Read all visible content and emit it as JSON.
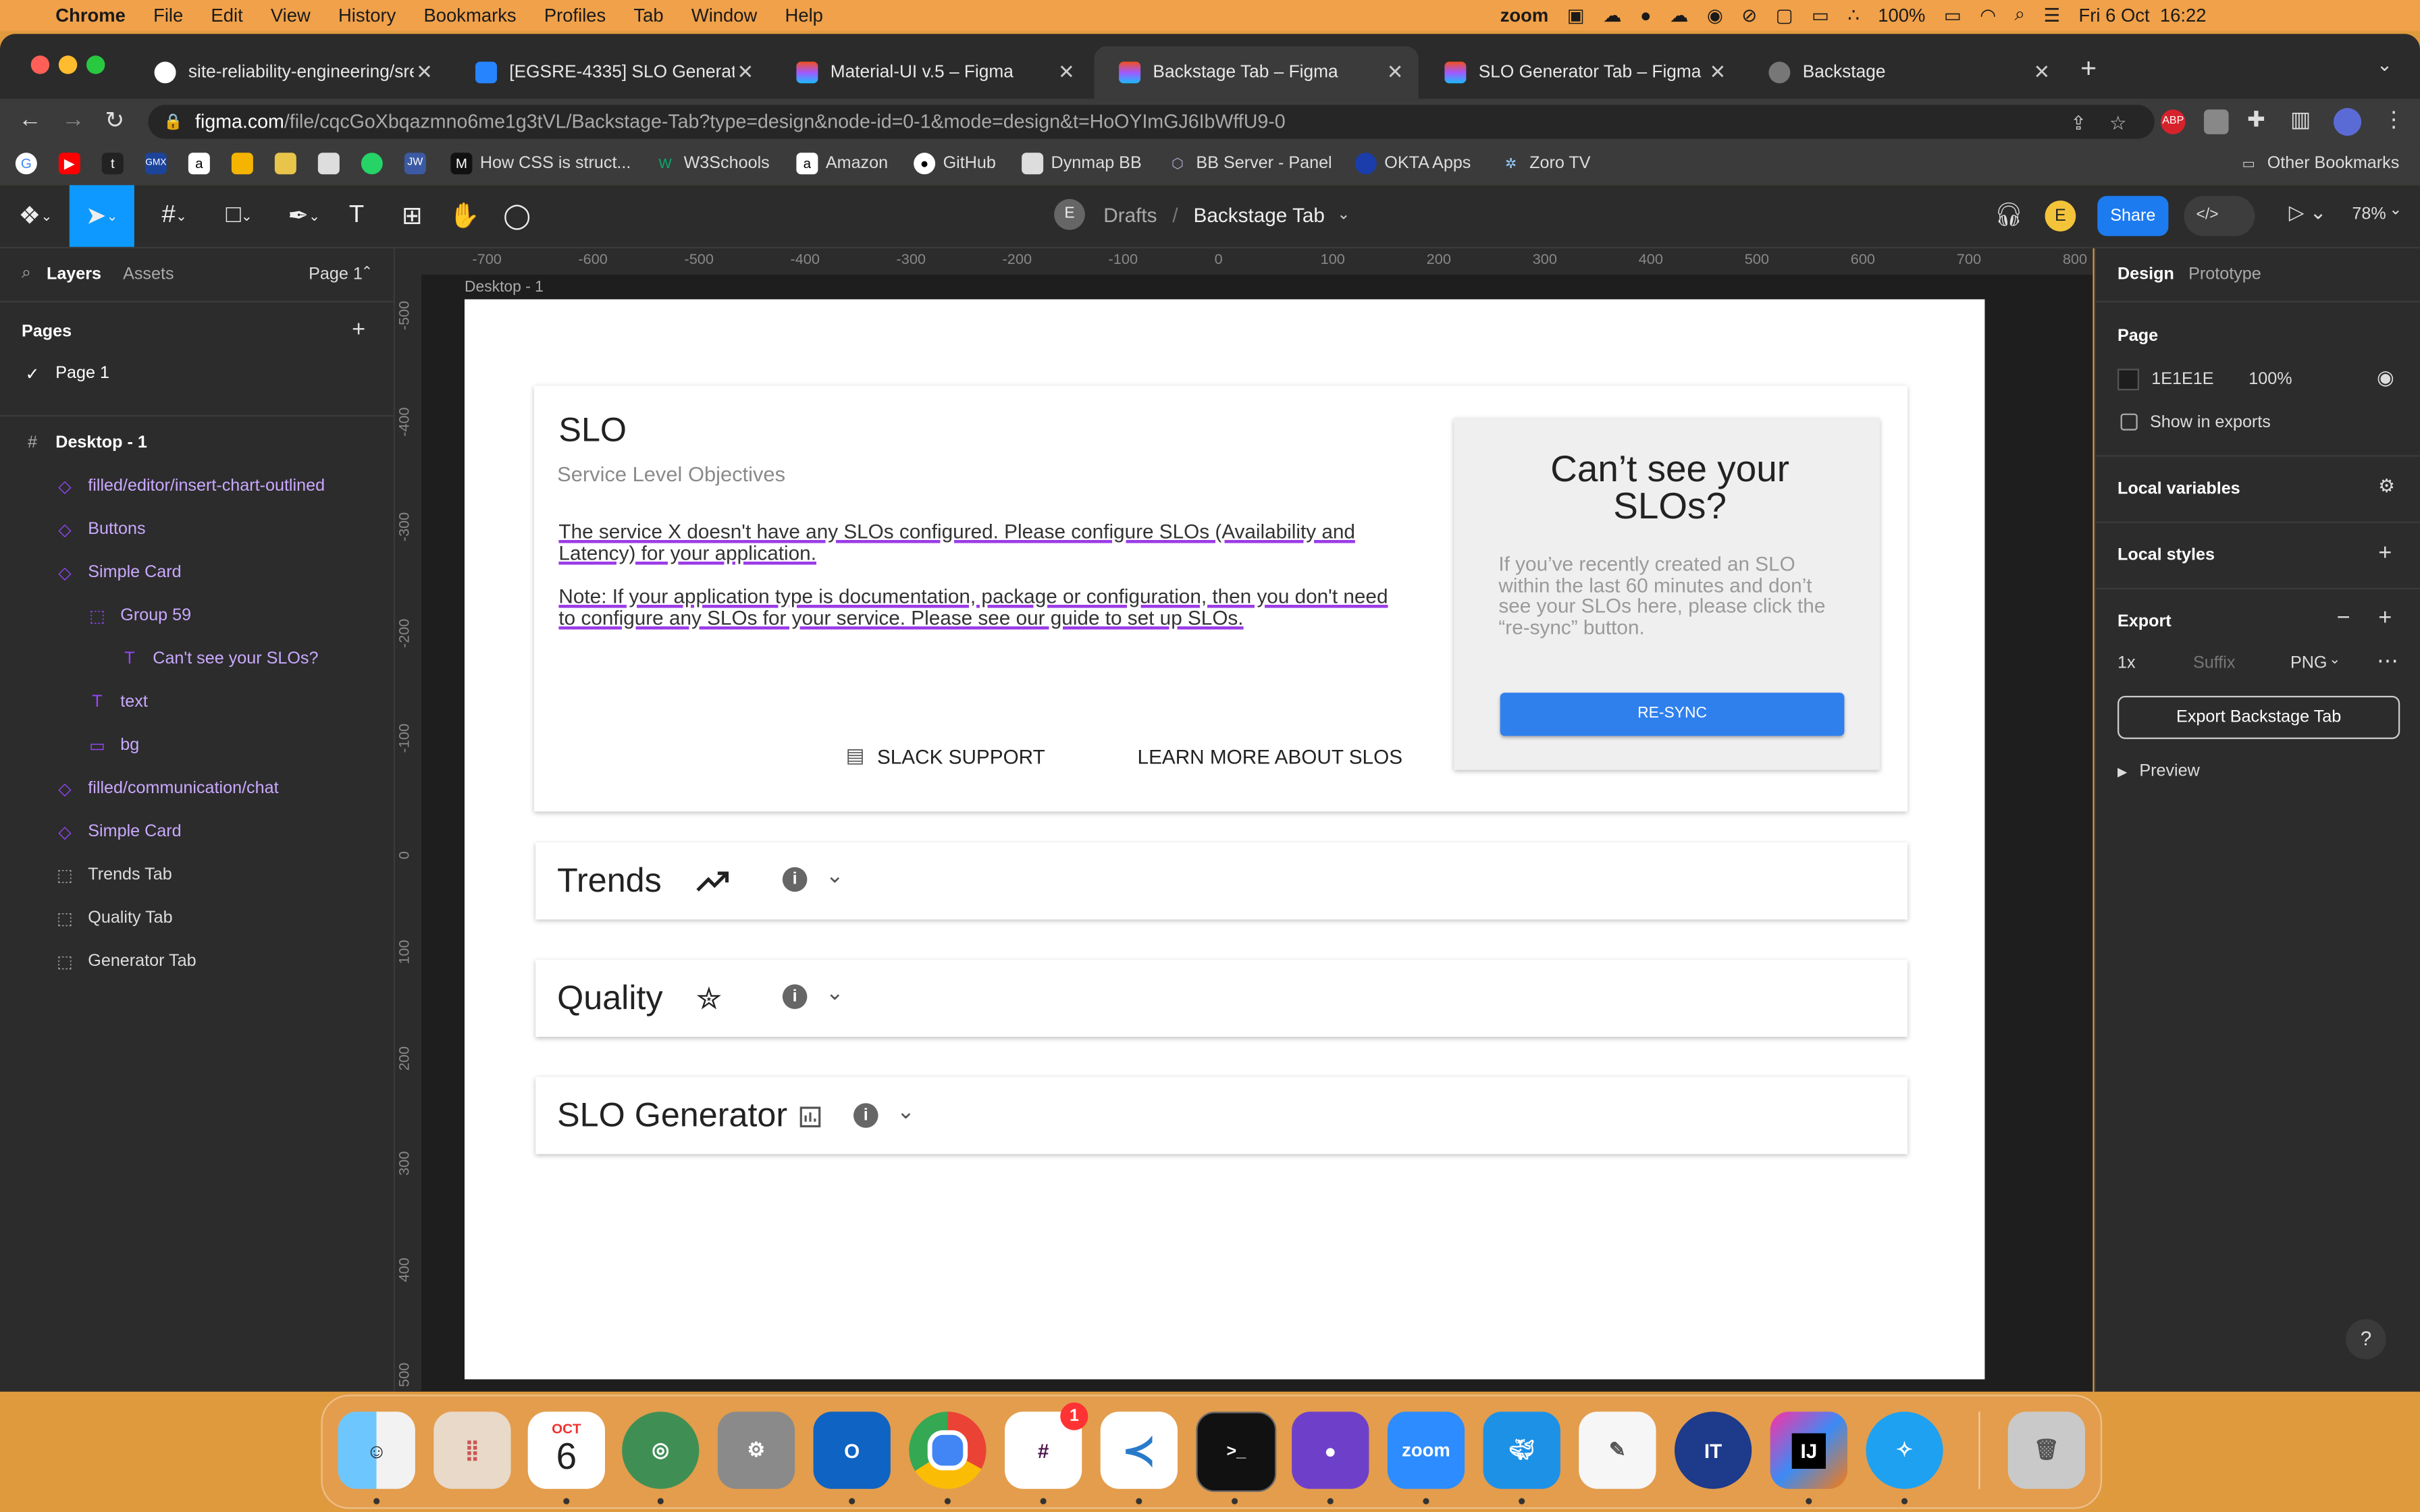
{
  "menubar": {
    "app": "Chrome",
    "items": [
      "File",
      "Edit",
      "View",
      "History",
      "Bookmarks",
      "Profiles",
      "Tab",
      "Window",
      "Help"
    ],
    "zoom_label": "zoom",
    "battery": "100%",
    "datetime": "Fri 6 Oct  16:22"
  },
  "browser": {
    "tabs": [
      {
        "title": "site-reliability-engineering/sre",
        "icon": "github-icon"
      },
      {
        "title": "[EGSRE-4335] SLO Generator",
        "icon": "jira-icon"
      },
      {
        "title": "Material-UI v.5 – Figma",
        "icon": "figma-icon"
      },
      {
        "title": "Backstage Tab – Figma",
        "icon": "figma-icon"
      },
      {
        "title": "SLO Generator Tab – Figma",
        "icon": "figma-icon"
      },
      {
        "title": "Backstage",
        "icon": "globe-icon"
      }
    ],
    "url_host": "figma.com",
    "url_path": "/file/cqcGoXbqazmno6me1g3tVL/Backstage-Tab?type=design&node-id=0-1&mode=design&t=HoOYImGJ6IbWffU9-0",
    "bookmarks": [
      "How CSS is struct...",
      "W3Schools",
      "Amazon",
      "GitHub",
      "Dynmap BB",
      "BB Server - Panel",
      "OKTA Apps",
      "Zoro TV"
    ],
    "other_bookmarks": "Other Bookmarks"
  },
  "figma": {
    "avatar_letter": "E",
    "breadcrumb_drafts": "Drafts",
    "breadcrumb_sep": "/",
    "file_name": "Backstage Tab",
    "share_label": "Share",
    "zoom": "78%",
    "left_tabs": {
      "layers": "Layers",
      "assets": "Assets",
      "page_select": "Page 1"
    },
    "pages_title": "Pages",
    "pages": [
      "Page 1"
    ],
    "layers": [
      {
        "name": "Desktop - 1",
        "icon": "#",
        "indent": 0,
        "bold": true
      },
      {
        "name": "filled/editor/insert-chart-outlined",
        "icon": "◇",
        "indent": 1,
        "purple": true
      },
      {
        "name": "Buttons",
        "icon": "◇",
        "indent": 1,
        "purple": true
      },
      {
        "name": "Simple Card",
        "icon": "◇",
        "indent": 1,
        "purple": true
      },
      {
        "name": "Group 59",
        "icon": "⬚",
        "indent": 2,
        "purple": true
      },
      {
        "name": "Can't see your SLOs?",
        "icon": "T",
        "indent": 3,
        "purple": true
      },
      {
        "name": "text",
        "icon": "T",
        "indent": 2,
        "purple": true
      },
      {
        "name": "bg",
        "icon": "▭",
        "indent": 2,
        "purple": true
      },
      {
        "name": "filled/communication/chat",
        "icon": "◇",
        "indent": 1,
        "purple": true
      },
      {
        "name": "Simple Card",
        "icon": "◇",
        "indent": 1,
        "purple": true
      },
      {
        "name": "Trends Tab",
        "icon": "⬚",
        "indent": 1,
        "purple": false
      },
      {
        "name": "Quality Tab",
        "icon": "⬚",
        "indent": 1,
        "purple": false
      },
      {
        "name": "Generator Tab",
        "icon": "⬚",
        "indent": 1,
        "purple": false
      }
    ],
    "right": {
      "tab_design": "Design",
      "tab_prototype": "Prototype",
      "page_label": "Page",
      "page_color": "1E1E1E",
      "page_opacity": "100%",
      "show_in_exports": "Show in exports",
      "local_variables": "Local variables",
      "local_styles": "Local styles",
      "export_label": "Export",
      "export_scale": "1x",
      "export_suffix": "Suffix",
      "export_format": "PNG",
      "export_button": "Export Backstage Tab",
      "preview": "Preview"
    },
    "ruler_h": [
      "-700",
      "-600",
      "-500",
      "-400",
      "-300",
      "-200",
      "-100",
      "0",
      "100",
      "200",
      "300",
      "400",
      "500",
      "600",
      "700",
      "800"
    ],
    "ruler_v": [
      "-500",
      "-400",
      "-300",
      "-200",
      "-100",
      "0",
      "100",
      "200",
      "300",
      "400",
      "500"
    ],
    "frame_label": "Desktop - 1"
  },
  "design": {
    "slo_title": "SLO",
    "slo_subtitle": "Service Level Objectives",
    "para1": "The service X doesn't have any SLOs configured. Please configure SLOs (Availability and Latency) for your application.",
    "para2": "Note: If your application type is documentation, package or configuration, then you don't need to configure any SLOs for your service. Please see our guide to set up SLOs.",
    "slack_btn": "SLACK SUPPORT",
    "learn_btn": "LEARN MORE ABOUT SLOS",
    "side_title": "Can’t see your SLOs?",
    "side_text": "If you’ve recently created an SLO within the last 60 minutes and don’t see your SLOs here, please click the “re-sync” button.",
    "resync": "RE-SYNC",
    "trends": "Trends",
    "quality": "Quality",
    "generator": "SLO Generator"
  },
  "dock": {
    "calendar_month": "OCT",
    "calendar_day": "6",
    "slack_badge": "1",
    "zoom": "zoom"
  },
  "colors": {
    "accent": "#0d99ff",
    "purple": "#9747ff",
    "resync": "#2f80ed"
  }
}
